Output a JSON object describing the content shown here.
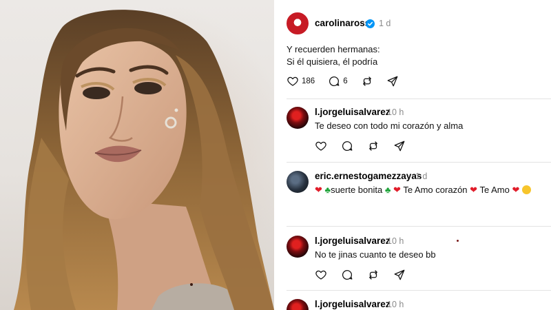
{
  "post": {
    "username": "carolinaross",
    "time": "1 d",
    "caption_line1": "Y recuerden hermanas:",
    "caption_line2": "Si él quisiera, él podría",
    "likes": "186",
    "comments": "6",
    "icons": [
      "heart-icon",
      "comment-icon",
      "repost-icon",
      "share-icon",
      "verified-icon"
    ]
  },
  "replies": [
    {
      "username": "l.jorgeluisalvarez",
      "time": "10 h",
      "text": "Te deseo con todo mi corazón y alma"
    },
    {
      "username": "eric.ernestogamezzayas",
      "time": "1 d",
      "segments": [
        "suerte bonita",
        "Te Amo corazón",
        "Te Amo"
      ]
    },
    {
      "username": "l.jorgeluisalvarez",
      "time": "10 h",
      "text": "No te jinas cuanto te deseo bb"
    },
    {
      "username": "l.jorgeluisalvarez",
      "time": "10 h"
    }
  ],
  "colors": {
    "accent_verified": "#0095f6",
    "heart_emoji": "#e11d2a",
    "clover_emoji": "#1fa33a",
    "divider": "#e3e3e3",
    "muted": "#8a8a8a"
  }
}
